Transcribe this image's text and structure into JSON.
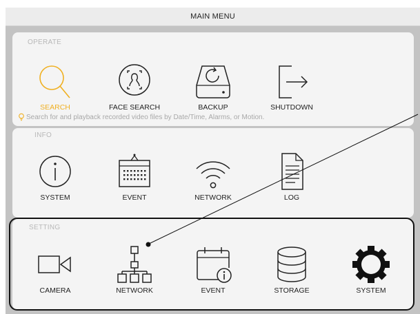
{
  "title": "MAIN MENU",
  "sections": {
    "operate": {
      "title": "OPERATE",
      "items": [
        {
          "label": "SEARCH",
          "icon": "search-icon",
          "active": true
        },
        {
          "label": "FACE SEARCH",
          "icon": "face-search-icon"
        },
        {
          "label": "BACKUP",
          "icon": "backup-icon"
        },
        {
          "label": "SHUTDOWN",
          "icon": "shutdown-icon"
        }
      ],
      "hint": "Search for and playback recorded video files by Date/Time, Alarms, or Motion."
    },
    "info": {
      "title": "INFO",
      "items": [
        {
          "label": "SYSTEM",
          "icon": "info-icon"
        },
        {
          "label": "EVENT",
          "icon": "calendar-icon"
        },
        {
          "label": "NETWORK",
          "icon": "wifi-icon"
        },
        {
          "label": "LOG",
          "icon": "log-document-icon"
        }
      ]
    },
    "setting": {
      "title": "SETTING",
      "items": [
        {
          "label": "CAMERA",
          "icon": "video-camera-icon"
        },
        {
          "label": "NETWORK",
          "icon": "network-tree-icon"
        },
        {
          "label": "EVENT",
          "icon": "event-calendar-info-icon"
        },
        {
          "label": "STORAGE",
          "icon": "database-storage-icon"
        },
        {
          "label": "SYSTEM",
          "icon": "gear-icon"
        }
      ]
    }
  },
  "colors": {
    "accent": "#f0b021",
    "panel": "#f4f4f4",
    "frame": "#c3c3c3"
  }
}
